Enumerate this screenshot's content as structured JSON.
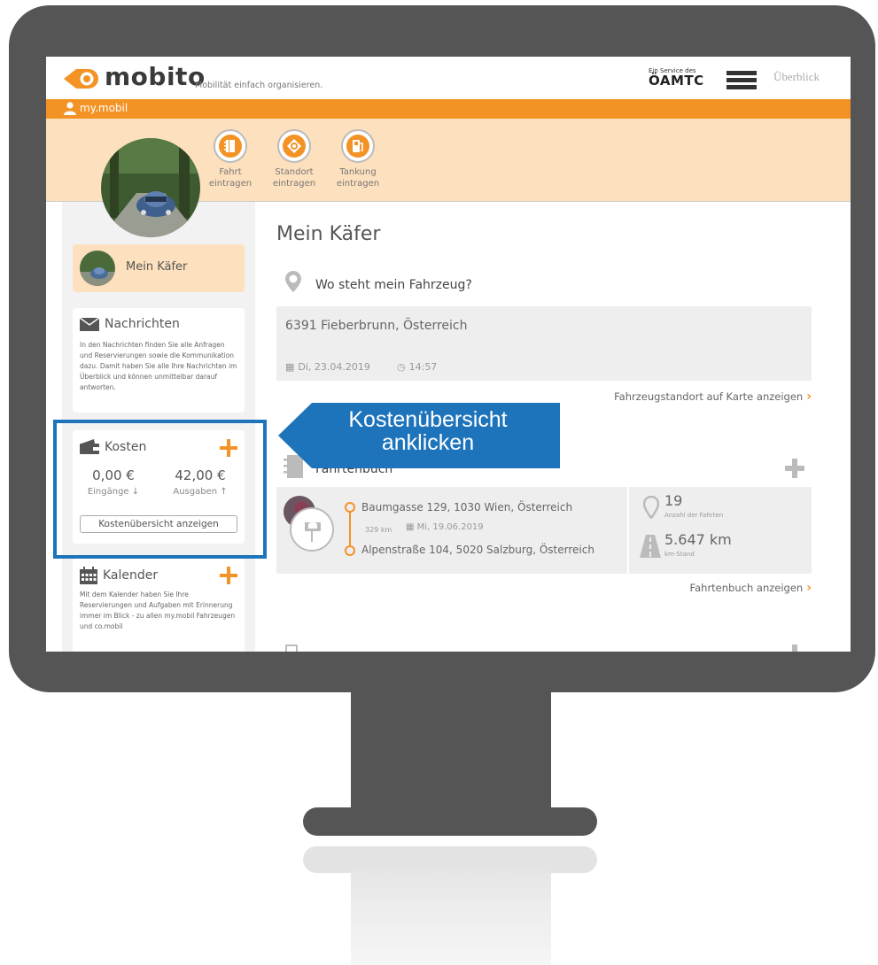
{
  "header": {
    "logo": "mobito",
    "tagline": "Mobilität einfach organisieren.",
    "service_small": "Ein Service des",
    "service_brand": "ÖAMTC",
    "overview_link": "Überblick"
  },
  "user_bar": {
    "label": "my.mobil"
  },
  "actions": [
    {
      "line1": "Fahrt",
      "line2": "eintragen",
      "icon": "notebook-icon"
    },
    {
      "line1": "Standort",
      "line2": "eintragen",
      "icon": "target-icon"
    },
    {
      "line1": "Tankung",
      "line2": "eintragen",
      "icon": "fuel-pump-icon"
    }
  ],
  "sidebar": {
    "vehicle_name": "Mein Käfer",
    "messages": {
      "title": "Nachrichten",
      "description": "In den Nachrichten finden Sie alle Anfragen und Reservierungen sowie die Kommunikation dazu. Damit haben Sie alle Ihre Nachrichten im Überblick und können unmittelbar darauf antworten."
    },
    "costs": {
      "title": "Kosten",
      "income_value": "0,00 €",
      "income_label": "Eingänge",
      "expense_value": "42,00 €",
      "expense_label": "Ausgaben",
      "button": "Kostenübersicht anzeigen"
    },
    "calendar": {
      "title": "Kalender",
      "description": "Mit dem Kalender haben Sie Ihre Reservierungen und Aufgaben mit Erinnerung immer im Blick - zu allen my.mobil Fahrzeugen und co.mobil"
    }
  },
  "main": {
    "title": "Mein Käfer",
    "location": {
      "heading": "Wo steht mein Fahrzeug?",
      "address": "6391 Fieberbrunn, Österreich",
      "date": "Di, 23.04.2019",
      "time": "14:57",
      "link": "Fahrzeugstandort auf Karte anzeigen"
    },
    "logbook": {
      "heading": "Fahrtenbuch",
      "from": "Baumgasse 129, 1030 Wien, Österreich",
      "distance": "329 km",
      "date": "Mi, 19.06.2019",
      "to": "Alpenstraße 104, 5020 Salzburg, Österreich",
      "trip_count": "19",
      "trip_count_label": "Anzahl der Fahrten",
      "odometer": "5.647 km",
      "odometer_label": "km-Stand",
      "link": "Fahrtenbuch anzeigen"
    }
  },
  "callout": {
    "line1": "Kostenübersicht",
    "line2": "anklicken"
  },
  "colors": {
    "orange": "#f39325",
    "peach": "#fde0bd",
    "callout_blue": "#1e74bb",
    "monitor": "#555555"
  }
}
